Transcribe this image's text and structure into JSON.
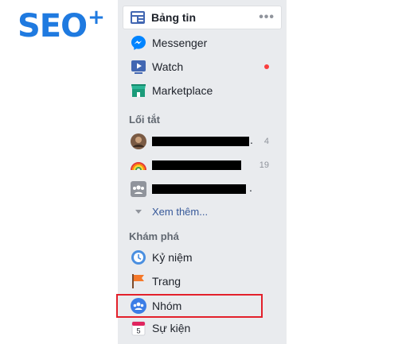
{
  "logo": {
    "text": "SEO",
    "superscript": "+",
    "color": "#1f7ae0"
  },
  "nav": {
    "items": [
      {
        "label": "Bảng tin",
        "icon": "news-feed-icon",
        "selected": true,
        "more": "•••"
      },
      {
        "label": "Messenger",
        "icon": "messenger-icon"
      },
      {
        "label": "Watch",
        "icon": "watch-icon",
        "notification": true
      },
      {
        "label": "Marketplace",
        "icon": "marketplace-icon"
      }
    ]
  },
  "shortcuts": {
    "title": "Lối tắt",
    "items": [
      {
        "icon": "profile-avatar-icon",
        "label_visible": "",
        "count": "4",
        "trailing": "."
      },
      {
        "icon": "rainbow-icon",
        "label_visible": "",
        "count": "19"
      },
      {
        "icon": "group-icon",
        "label_visible": "",
        "trailing": "."
      }
    ],
    "see_more": "Xem thêm..."
  },
  "explore": {
    "title": "Khám phá",
    "items": [
      {
        "label": "Kỷ niệm",
        "icon": "memories-icon"
      },
      {
        "label": "Trang",
        "icon": "pages-flag-icon"
      },
      {
        "label": "Nhóm",
        "icon": "groups-icon",
        "highlighted": true
      },
      {
        "label": "Sự kiện",
        "icon": "events-calendar-icon",
        "calendar_day": "5"
      }
    ]
  },
  "colors": {
    "panel_bg": "#e9ebee",
    "link": "#365899",
    "highlight": "#e3202b",
    "notification": "#fa3e3e"
  }
}
